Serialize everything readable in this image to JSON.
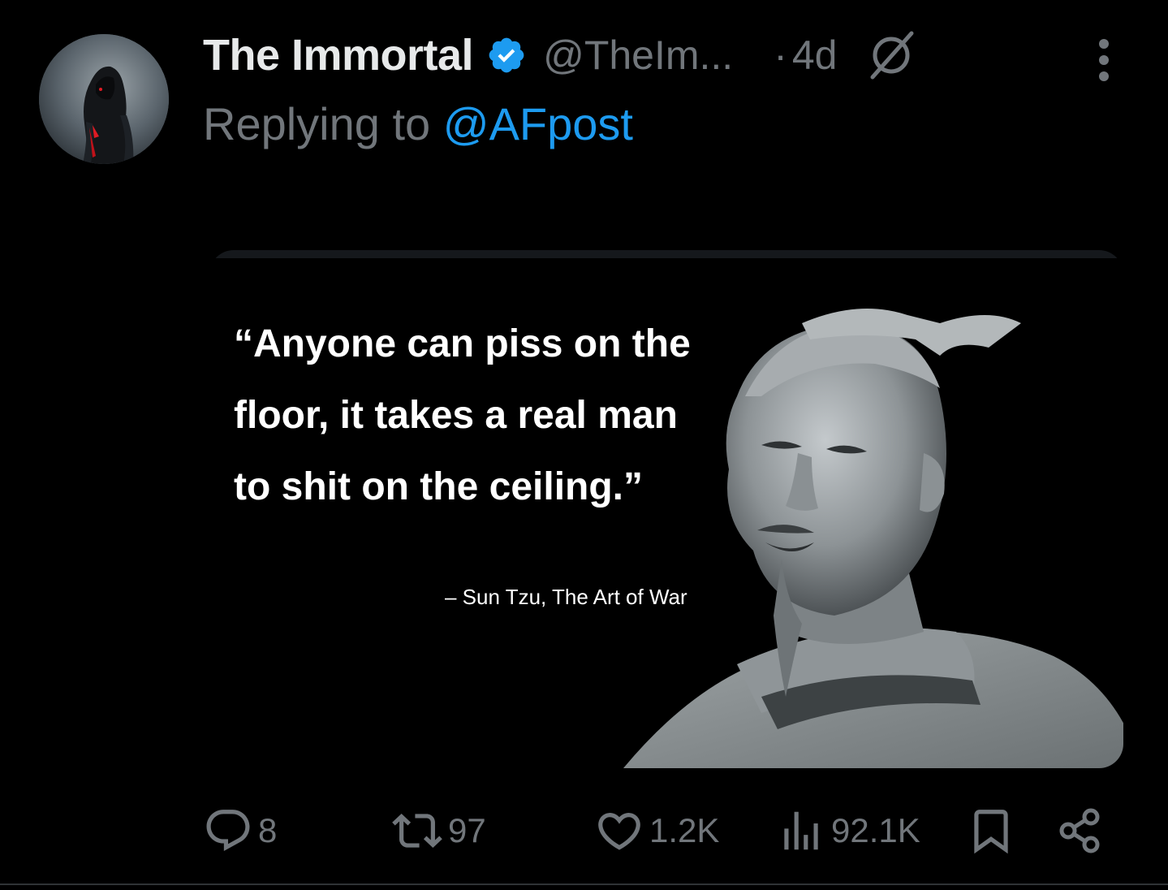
{
  "tweet": {
    "display_name": "The Immortal",
    "handle": "@TheIm...",
    "separator": "·",
    "time": "4d",
    "reply_prefix": "Replying to",
    "reply_mention": "@AFpost",
    "verified_icon": "verified-badge-icon",
    "more_icon": "more-vertical-icon",
    "status_icon": "no-sign-icon"
  },
  "media": {
    "quote": "“Anyone can piss on the floor, it takes a real man to shit on the ceiling.”",
    "attribution": "– Sun Tzu, The Art of War"
  },
  "actions": {
    "replies": "8",
    "reposts": "97",
    "likes": "1.2K",
    "views": "92.1K",
    "icons": [
      "reply-icon",
      "repost-icon",
      "like-icon",
      "views-icon",
      "bookmark-icon",
      "share-icon"
    ]
  },
  "colors": {
    "background": "#000000",
    "text_primary": "#e7e9ea",
    "text_secondary": "#71767b",
    "accent": "#1d9bf0"
  }
}
